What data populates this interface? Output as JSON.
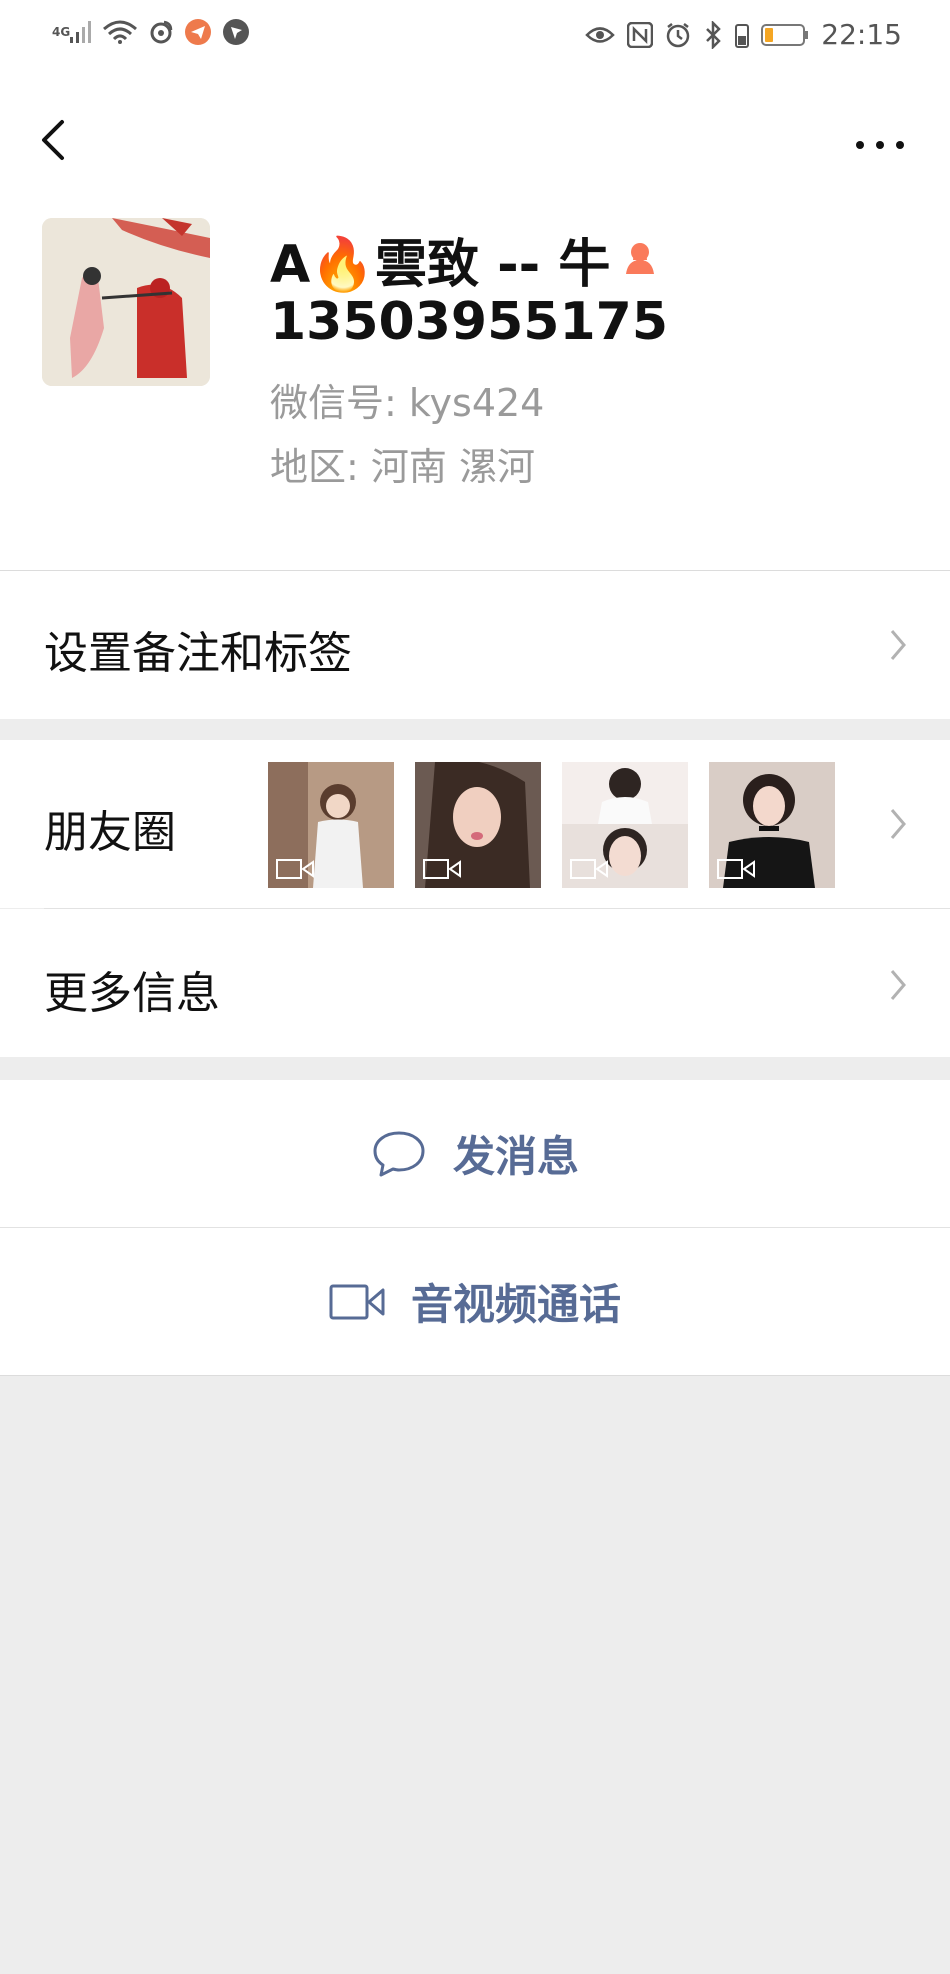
{
  "status_bar": {
    "network": "4G",
    "time": "22:15"
  },
  "profile": {
    "name": "A🔥雲致 -- 牛",
    "phone": "13503955175",
    "wechat_id": "微信号:  kys424",
    "region": "地区:  河南  漯河",
    "gender_icon": "female-icon"
  },
  "menu": {
    "remark_label": "设置备注和标签",
    "moments_label": "朋友圈",
    "more_info_label": "更多信息"
  },
  "actions": {
    "send_message": "发消息",
    "av_call": "音视频通话"
  },
  "colors": {
    "link_blue": "#576b95",
    "page_bg": "#ededed",
    "secondary_text": "#9a9a9a",
    "gender_badge": "#fa7a5b"
  }
}
